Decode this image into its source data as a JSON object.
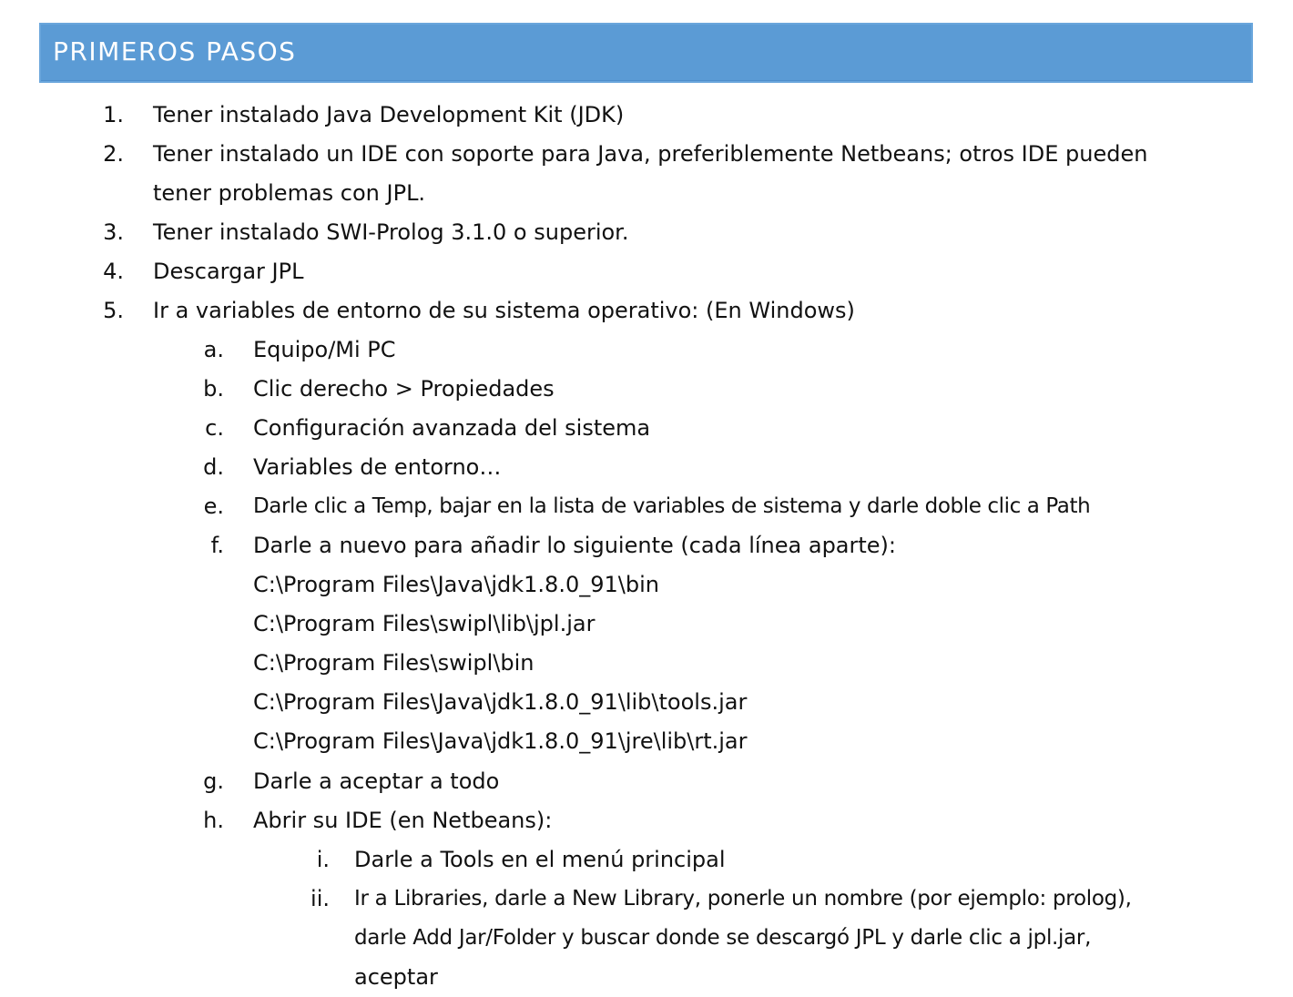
{
  "heading": "PRIMEROS PASOS",
  "steps": [
    {
      "marker": "1.",
      "text": "Tener instalado Java Development Kit (JDK)"
    },
    {
      "marker": "2.",
      "lines": [
        "Tener instalado un IDE con soporte para Java, preferiblemente Netbeans; otros IDE pueden",
        "tener problemas con JPL."
      ]
    },
    {
      "marker": "3.",
      "text": "Tener instalado SWI-Prolog 3.1.0 o superior."
    },
    {
      "marker": "4.",
      "text": "Descargar JPL"
    },
    {
      "marker": "5.",
      "text": "Ir a variables de entorno de su sistema operativo: (En Windows)",
      "substeps": [
        {
          "marker": "a.",
          "text": "Equipo/Mi PC"
        },
        {
          "marker": "b.",
          "text": "Clic derecho > Propiedades"
        },
        {
          "marker": "c.",
          "text": "Configuración avanzada del sistema"
        },
        {
          "marker": "d.",
          "text": "Variables de entorno…"
        },
        {
          "marker": "e.",
          "text": "Darle clic a Temp, bajar en la lista de variables de sistema y darle doble clic a Path"
        },
        {
          "marker": "f.",
          "text": "Darle a nuevo para añadir lo siguiente (cada línea aparte):",
          "paths": [
            "C:\\Program Files\\Java\\jdk1.8.0_91\\bin",
            "C:\\Program Files\\swipl\\lib\\jpl.jar",
            "C:\\Program Files\\swipl\\bin",
            "C:\\Program Files\\Java\\jdk1.8.0_91\\lib\\tools.jar",
            "C:\\Program Files\\Java\\jdk1.8.0_91\\jre\\lib\\rt.jar"
          ]
        },
        {
          "marker": "g.",
          "text": "Darle a aceptar a todo"
        },
        {
          "marker": "h.",
          "text": "Abrir su IDE (en Netbeans):",
          "subsubsteps": [
            {
              "marker": "i.",
              "text": "Darle a Tools en el menú principal"
            },
            {
              "marker": "ii.",
              "lines": [
                "Ir a Libraries, darle a New Library, ponerle un nombre (por ejemplo: prolog),",
                "darle Add Jar/Folder y buscar donde se descargó JPL y darle clic a jpl.jar,",
                "aceptar"
              ]
            }
          ]
        }
      ]
    }
  ]
}
